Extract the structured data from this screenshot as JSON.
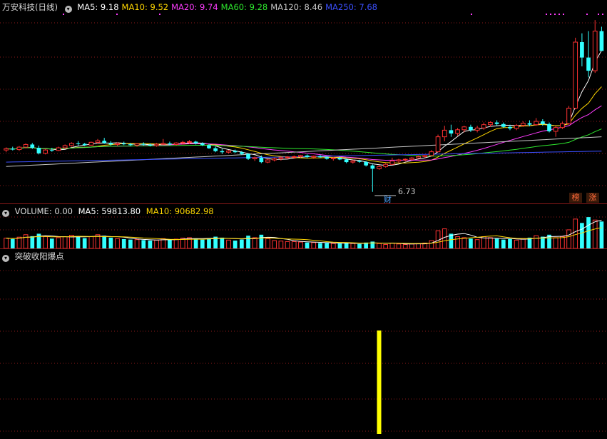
{
  "stock": {
    "title": "万安科技(日线)",
    "ma": [
      {
        "label": "MA5: 9.18",
        "color": "#ffffff"
      },
      {
        "label": "MA10: 9.52",
        "color": "#ffd700"
      },
      {
        "label": "MA20: 9.74",
        "color": "#ff3cff"
      },
      {
        "label": "MA60: 9.28",
        "color": "#2ee82e"
      },
      {
        "label": "MA120: 8.46",
        "color": "#c8c8c8"
      },
      {
        "label": "MA250: 7.68",
        "color": "#3c50ff"
      }
    ],
    "low_label": "6.73",
    "cai_label": "财",
    "badges": [
      "榜",
      "涨"
    ]
  },
  "volume": {
    "title": "VOLUME: 0.00",
    "ma5": "MA5: 59813.80",
    "ma10": "MA10: 90682.98"
  },
  "indicator": {
    "title": "突破收阳爆点"
  },
  "colors": {
    "up": "#ff3232",
    "down": "#32ffff",
    "grid": "#8b1a1a",
    "signal": "#ffff00"
  },
  "chart_data": {
    "type": "candlestick",
    "series": [
      "open",
      "high",
      "low",
      "close",
      "volume"
    ],
    "candles": [
      [
        8.8,
        8.92,
        8.7,
        8.86,
        21
      ],
      [
        8.86,
        8.95,
        8.78,
        8.82,
        19
      ],
      [
        8.82,
        8.98,
        8.76,
        8.93,
        23
      ],
      [
        8.93,
        9.1,
        8.88,
        9.05,
        28
      ],
      [
        9.05,
        9.12,
        8.85,
        8.9,
        25
      ],
      [
        8.9,
        9.0,
        8.6,
        8.65,
        30
      ],
      [
        8.65,
        8.85,
        8.6,
        8.8,
        24
      ],
      [
        8.8,
        8.9,
        8.72,
        8.78,
        20
      ],
      [
        8.78,
        8.95,
        8.75,
        8.9,
        22
      ],
      [
        8.9,
        9.05,
        8.85,
        9.0,
        24
      ],
      [
        9.0,
        9.15,
        8.95,
        9.1,
        27
      ],
      [
        9.1,
        9.2,
        9.0,
        9.08,
        25
      ],
      [
        9.08,
        9.12,
        8.98,
        9.02,
        21
      ],
      [
        9.02,
        9.18,
        9.0,
        9.15,
        24
      ],
      [
        9.15,
        9.3,
        9.1,
        9.22,
        28
      ],
      [
        9.22,
        9.35,
        9.08,
        9.12,
        26
      ],
      [
        9.12,
        9.2,
        9.0,
        9.05,
        22
      ],
      [
        9.05,
        9.15,
        8.98,
        9.1,
        20
      ],
      [
        9.1,
        9.18,
        9.02,
        9.06,
        19
      ],
      [
        9.06,
        9.12,
        8.98,
        9.02,
        18
      ],
      [
        9.02,
        9.1,
        8.95,
        9.08,
        18
      ],
      [
        9.08,
        9.15,
        9.0,
        9.04,
        17
      ],
      [
        9.04,
        9.1,
        8.96,
        9.0,
        16
      ],
      [
        9.0,
        9.12,
        8.95,
        9.06,
        17
      ],
      [
        9.06,
        9.3,
        9.02,
        9.1,
        20
      ],
      [
        9.1,
        9.18,
        9.02,
        9.05,
        18
      ],
      [
        9.05,
        9.15,
        9.0,
        9.12,
        19
      ],
      [
        9.12,
        9.22,
        9.05,
        9.15,
        21
      ],
      [
        9.15,
        9.25,
        9.08,
        9.18,
        22
      ],
      [
        9.18,
        9.22,
        9.05,
        9.1,
        20
      ],
      [
        9.1,
        9.15,
        8.98,
        9.02,
        18
      ],
      [
        9.02,
        9.08,
        8.85,
        8.88,
        21
      ],
      [
        8.88,
        8.95,
        8.7,
        8.75,
        24
      ],
      [
        8.75,
        8.85,
        8.62,
        8.7,
        22
      ],
      [
        8.7,
        8.8,
        8.65,
        8.76,
        17
      ],
      [
        8.76,
        8.82,
        8.66,
        8.7,
        16
      ],
      [
        8.7,
        8.75,
        8.58,
        8.62,
        18
      ],
      [
        8.62,
        8.65,
        8.35,
        8.4,
        26
      ],
      [
        8.4,
        8.5,
        8.3,
        8.45,
        22
      ],
      [
        8.45,
        8.55,
        8.2,
        8.25,
        28
      ],
      [
        8.25,
        8.4,
        8.2,
        8.35,
        20
      ],
      [
        8.35,
        8.45,
        8.28,
        8.4,
        16
      ],
      [
        8.4,
        8.5,
        8.32,
        8.45,
        15
      ],
      [
        8.45,
        8.52,
        8.38,
        8.48,
        14
      ],
      [
        8.48,
        8.55,
        8.4,
        8.5,
        14
      ],
      [
        8.5,
        8.58,
        8.45,
        8.55,
        13
      ],
      [
        8.55,
        8.6,
        8.42,
        8.48,
        12
      ],
      [
        8.48,
        8.55,
        8.4,
        8.52,
        12
      ],
      [
        8.52,
        8.58,
        8.44,
        8.47,
        11
      ],
      [
        8.47,
        8.52,
        8.36,
        8.4,
        11
      ],
      [
        8.4,
        8.48,
        8.32,
        8.44,
        10
      ],
      [
        8.44,
        8.5,
        8.34,
        8.37,
        10
      ],
      [
        8.37,
        8.42,
        8.2,
        8.25,
        12
      ],
      [
        8.25,
        8.35,
        8.18,
        8.3,
        10
      ],
      [
        8.3,
        8.36,
        8.22,
        8.26,
        9
      ],
      [
        8.26,
        8.3,
        8.05,
        8.1,
        12
      ],
      [
        8.1,
        8.15,
        6.9,
        7.95,
        14
      ],
      [
        7.95,
        8.12,
        7.9,
        8.05,
        10
      ],
      [
        8.05,
        8.2,
        8.0,
        8.15,
        8
      ],
      [
        8.15,
        8.45,
        8.12,
        8.3,
        11
      ],
      [
        8.3,
        8.4,
        8.22,
        8.35,
        9
      ],
      [
        8.35,
        8.42,
        8.28,
        8.38,
        8
      ],
      [
        8.38,
        8.48,
        8.3,
        8.44,
        9
      ],
      [
        8.44,
        8.55,
        8.4,
        8.5,
        10
      ],
      [
        8.5,
        8.58,
        8.45,
        8.55,
        11
      ],
      [
        8.55,
        8.8,
        8.5,
        8.72,
        16
      ],
      [
        8.72,
        9.5,
        8.7,
        9.4,
        36
      ],
      [
        9.4,
        9.9,
        9.2,
        9.7,
        40
      ],
      [
        9.7,
        9.95,
        9.4,
        9.55,
        30
      ],
      [
        9.55,
        9.8,
        9.45,
        9.72,
        24
      ],
      [
        9.72,
        9.9,
        9.6,
        9.85,
        22
      ],
      [
        9.85,
        9.95,
        9.62,
        9.7,
        20
      ],
      [
        9.7,
        9.9,
        9.6,
        9.8,
        18
      ],
      [
        9.8,
        10.05,
        9.72,
        9.95,
        24
      ],
      [
        9.95,
        10.1,
        9.85,
        10.05,
        22
      ],
      [
        10.05,
        10.15,
        9.9,
        9.98,
        20
      ],
      [
        9.98,
        10.05,
        9.8,
        9.85,
        18
      ],
      [
        9.85,
        9.95,
        9.7,
        9.78,
        19
      ],
      [
        9.78,
        9.98,
        9.7,
        9.92,
        17
      ],
      [
        9.92,
        10.1,
        9.85,
        10.02,
        20
      ],
      [
        10.02,
        10.15,
        9.88,
        9.95,
        22
      ],
      [
        9.95,
        10.25,
        9.9,
        10.1,
        26
      ],
      [
        10.1,
        10.2,
        9.9,
        9.98,
        24
      ],
      [
        9.98,
        10.05,
        9.6,
        9.65,
        28
      ],
      [
        9.65,
        9.9,
        9.4,
        9.82,
        22
      ],
      [
        9.82,
        10.08,
        9.75,
        10.0,
        24
      ],
      [
        10.0,
        10.8,
        9.95,
        10.7,
        38
      ],
      [
        10.7,
        13.9,
        10.65,
        13.7,
        60
      ],
      [
        13.7,
        14.1,
        12.6,
        13.0,
        52
      ],
      [
        13.0,
        14.2,
        12.1,
        12.4,
        64
      ],
      [
        12.4,
        14.7,
        12.3,
        14.2,
        58
      ],
      [
        14.2,
        14.4,
        13.5,
        13.3,
        55
      ]
    ],
    "price_range": [
      6.6,
      14.9
    ],
    "low_marker": 6.73,
    "volume_range": [
      0,
      70
    ],
    "indicator_signal_index": 57
  }
}
